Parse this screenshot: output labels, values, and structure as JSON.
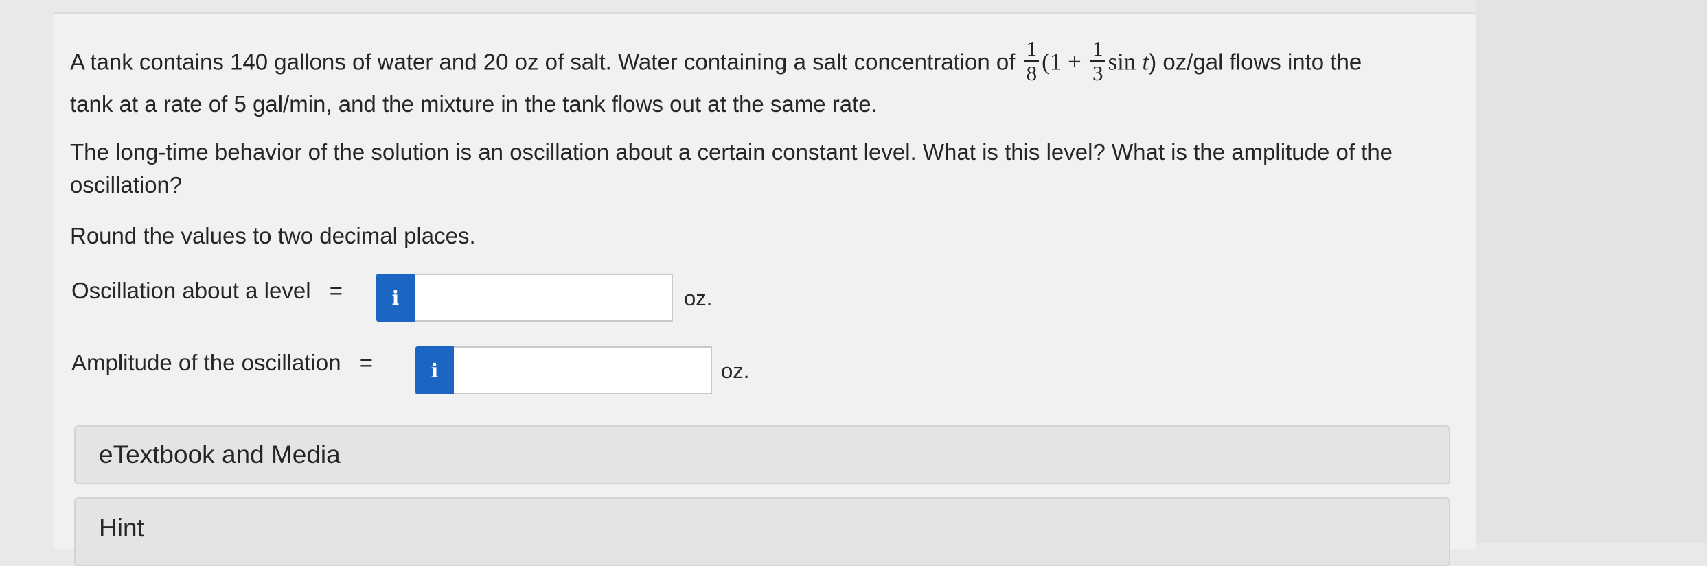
{
  "question": {
    "line1_before": "A tank contains 140 gallons of water and 20 oz of salt. Water containing a salt concentration of",
    "frac1_num": "1",
    "frac1_den": "8",
    "paren_open": "(1 +",
    "frac2_num": "1",
    "frac2_den": "3",
    "sin": "sin",
    "t_var": "t",
    "line1_after": ") oz/gal flows into the",
    "line2": "tank at a rate of 5 gal/min, and the mixture in the tank flows out at the same rate.",
    "line3": "The long-time behavior of the solution is an oscillation about a certain constant level. What is this level? What is the amplitude of the",
    "line4": "oscillation?",
    "line5": "Round the values to two decimal places."
  },
  "answers": {
    "level_label": "Oscillation about a level",
    "amplitude_label": "Amplitude of the oscillation",
    "equals": "=",
    "info_glyph": "i",
    "level_value": "",
    "amplitude_value": "",
    "unit": "oz."
  },
  "sections": {
    "etextbook": "eTextbook and Media",
    "hint": "Hint"
  },
  "colors": {
    "info_button": "#1a66c2",
    "page_background": "#e9e9e9",
    "panel_background": "#f1f1f1"
  }
}
